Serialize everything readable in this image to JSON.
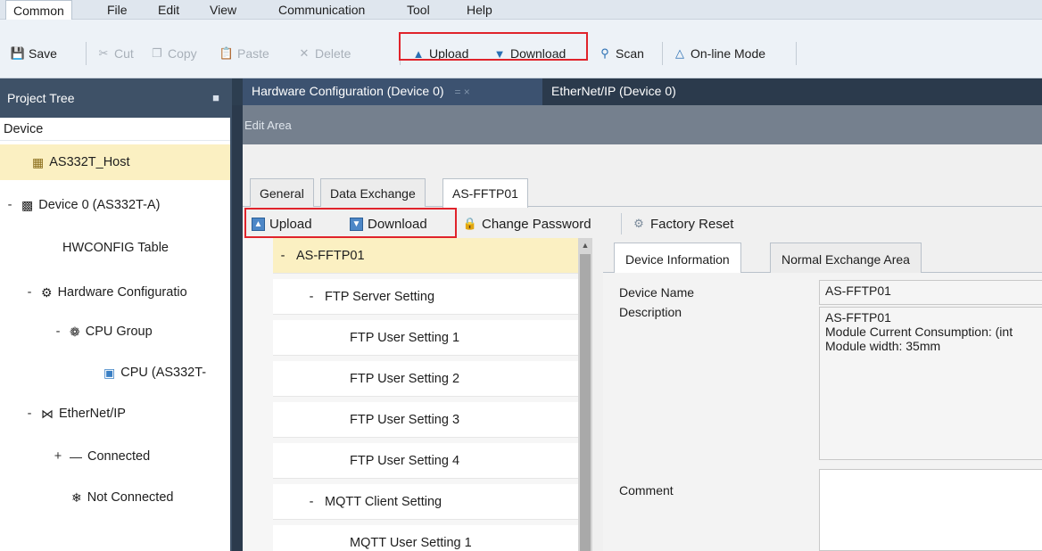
{
  "menu": {
    "items": [
      "Common",
      "File",
      "Edit",
      "View",
      "Communication",
      "Tool",
      "Help"
    ],
    "active": "Common"
  },
  "toolbar": {
    "save": "Save",
    "cut": "Cut",
    "copy": "Copy",
    "paste": "Paste",
    "delete": "Delete",
    "upload": "Upload",
    "download": "Download",
    "scan": "Scan",
    "online_mode": "On-line Mode"
  },
  "project_tree": {
    "title": "Project Tree",
    "root": "Device",
    "items": [
      {
        "label": "AS332T_Host",
        "icon": "host-icon",
        "expander": ""
      },
      {
        "label": "Device 0 (AS332T-A)",
        "icon": "device-icon",
        "expander": "-"
      },
      {
        "label": "HWCONFIG Table",
        "icon": "",
        "expander": ""
      },
      {
        "label": "Hardware Configuratio",
        "icon": "hardware-config-icon",
        "expander": "-"
      },
      {
        "label": "CPU Group",
        "icon": "cpu-group-icon",
        "expander": "-"
      },
      {
        "label": "CPU (AS332T-",
        "icon": "cpu-icon",
        "expander": ""
      },
      {
        "label": "EtherNet/IP",
        "icon": "ethernet-ip-icon",
        "expander": "-"
      },
      {
        "label": "Connected",
        "icon": "connected-icon",
        "expander": "+"
      },
      {
        "label": "Not Connected",
        "icon": "not-connected-icon",
        "expander": ""
      }
    ]
  },
  "doc_tabs": [
    {
      "label": "Hardware Configuration (Device 0)",
      "pin": "= ×"
    },
    {
      "label": "EtherNet/IP (Device 0)",
      "pin": ""
    }
  ],
  "edit_area": {
    "title": "Edit Area",
    "tabs": [
      "General",
      "Data Exchange",
      "AS-FFTP01"
    ],
    "active_tab": "AS-FFTP01",
    "sub_toolbar": {
      "upload": "Upload",
      "download": "Download",
      "change_password": "Change Password",
      "factory_reset": "Factory Reset"
    },
    "settings_tree": [
      {
        "label": "AS-FFTP01",
        "expander": "-",
        "selected": true
      },
      {
        "label": "FTP Server Setting",
        "expander": "-",
        "selected": false
      },
      {
        "label": "FTP User Setting 1",
        "expander": "",
        "selected": false
      },
      {
        "label": "FTP User Setting 2",
        "expander": "",
        "selected": false
      },
      {
        "label": "FTP User Setting 3",
        "expander": "",
        "selected": false
      },
      {
        "label": "FTP User Setting 4",
        "expander": "",
        "selected": false
      },
      {
        "label": "MQTT Client Setting",
        "expander": "-",
        "selected": false
      },
      {
        "label": "MQTT User Setting 1",
        "expander": "",
        "selected": false
      }
    ],
    "info_tabs": [
      "Device Information",
      "Normal Exchange Area"
    ],
    "device_info": {
      "name_label": "Device Name",
      "name_value": "AS-FFTP01",
      "description_label": "Description",
      "description_lines": [
        "AS-FFTP01",
        "Module Current Consumption: (int",
        "Module width: 35mm"
      ],
      "comment_label": "Comment",
      "comment_value": ""
    }
  },
  "colors": {
    "highlight": "#e0232b",
    "selected_row": "#fbf0c2",
    "panel_header": "#3e5167"
  }
}
